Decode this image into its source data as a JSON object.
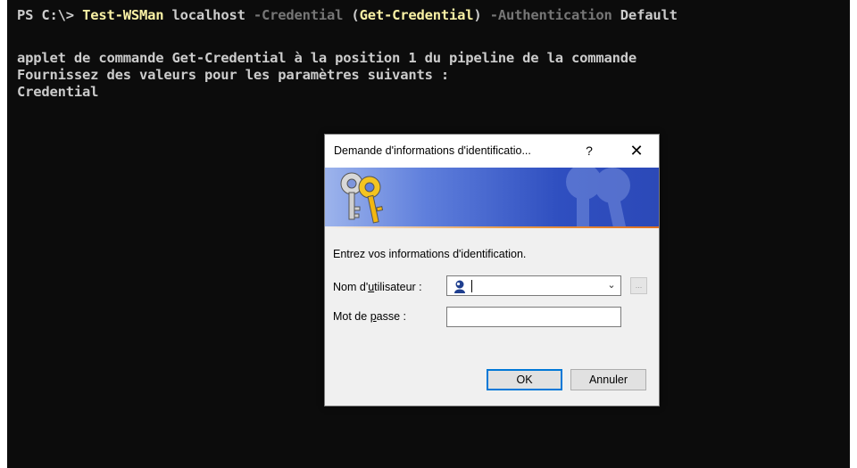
{
  "terminal": {
    "prompt": "PS C:\\> ",
    "cmdlet": "Test-WSMan",
    "arg1": " localhost ",
    "param1": "-Credential",
    "paren_open": " (",
    "subcmd": "Get-Credential",
    "paren_close": ")",
    "param2": " -Authentication",
    "arg2": " Default",
    "line2": "applet de commande Get-Credential à la position 1 du pipeline de la commande",
    "line3": "Fournissez des valeurs pour les paramètres suivants :",
    "line4": "Credential",
    "colors": {
      "background": "#0c0c0c",
      "text": "#cccccc",
      "command": "#f9f1a5",
      "parameter": "#767676"
    }
  },
  "dialog": {
    "title": "Demande d'informations d'identificatio...",
    "help_label": "?",
    "close_label": "✕",
    "banner_icon": "keys-icon",
    "prompt_text": "Entrez vos informations d'identification.",
    "username_label_pre": "Nom d'",
    "username_label_accel": "u",
    "username_label_post": "tilisateur :",
    "username_value": "",
    "username_icon": "user-icon",
    "browse_label": "...",
    "password_label_pre": "Mot de ",
    "password_label_accel": "p",
    "password_label_post": "asse :",
    "password_value": "",
    "ok_label": "OK",
    "cancel_label": "Annuler",
    "colors": {
      "accent": "#0078d7",
      "banner_dark": "#2c49b8",
      "banner_light": "#9db4ec",
      "banner_line": "#e07020"
    }
  }
}
